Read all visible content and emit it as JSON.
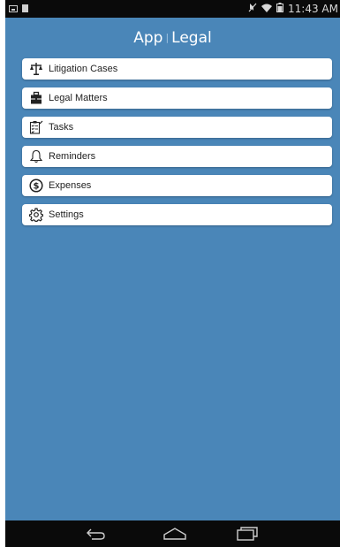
{
  "status_bar": {
    "time": "11:43 AM",
    "icons": [
      "image-icon",
      "square-icon",
      "mute-icon",
      "wifi-icon",
      "battery-icon"
    ]
  },
  "header": {
    "title_left": "App",
    "title_sep": "|",
    "title_right": "Legal"
  },
  "menu": {
    "items": [
      {
        "label": "Litigation Cases",
        "icon": "scales-icon"
      },
      {
        "label": "Legal Matters",
        "icon": "briefcase-icon"
      },
      {
        "label": "Tasks",
        "icon": "clipboard-icon"
      },
      {
        "label": "Reminders",
        "icon": "bell-icon"
      },
      {
        "label": "Expenses",
        "icon": "dollar-icon"
      },
      {
        "label": "Settings",
        "icon": "gear-icon"
      }
    ]
  },
  "nav_bar": {
    "buttons": [
      "back-icon",
      "home-icon",
      "recents-icon"
    ]
  },
  "colors": {
    "background": "#4a86b8",
    "card": "#ffffff",
    "system_bar": "#0a0a0a"
  }
}
